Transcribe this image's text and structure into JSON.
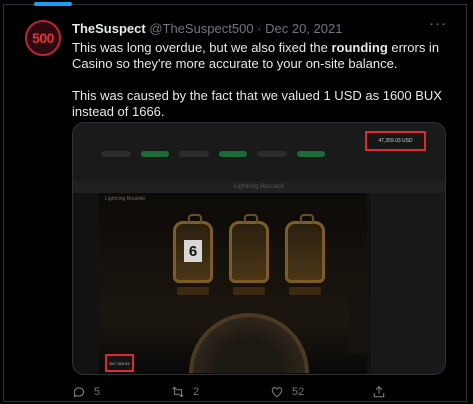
{
  "tweet": {
    "avatar_text": "500",
    "display_name": "TheSuspect",
    "handle_date": "@TheSuspect500 · Dec 20, 2021",
    "paragraph1_before": "This was long overdue, but we also fixed the ",
    "paragraph1_bold": "rounding",
    "paragraph1_after": " errors in Casino so they're more accurate to your on-site balance.",
    "paragraph2": "This was caused by the fact that we valued 1 USD as 1600 BUX instead of 1666."
  },
  "media": {
    "balance_text": "47,359.03 USD",
    "game_header": "Lightning Baccarat",
    "game_title": "Lightning Roulette",
    "pod_number": "6",
    "bet_label": "Balance",
    "bet_value": "$47,359.03"
  },
  "actions": {
    "reply_count": "5",
    "retweet_count": "2",
    "like_count": "52"
  },
  "colors": {
    "accent": "#1d9bf0",
    "highlight_box": "#e0282e",
    "avatar_red": "#e5323e"
  }
}
